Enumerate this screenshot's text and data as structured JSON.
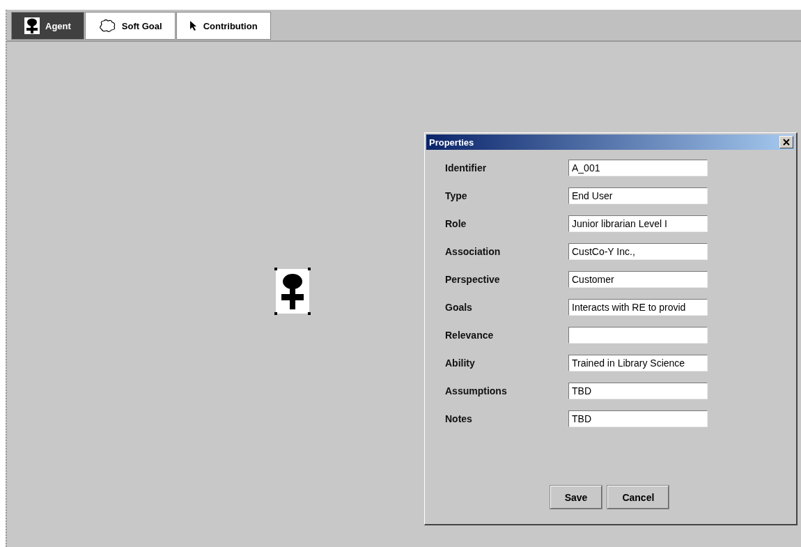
{
  "toolbar": {
    "tools": [
      {
        "kind": "agent",
        "label": "Agent",
        "selected": true
      },
      {
        "kind": "softgoal",
        "label": "Soft Goal",
        "selected": false
      },
      {
        "kind": "pointer",
        "label": "Contribution",
        "selected": false
      }
    ]
  },
  "canvas": {
    "nodes": [
      {
        "kind": "agent",
        "selected": true
      }
    ]
  },
  "dialog": {
    "title": "Properties",
    "fields": [
      {
        "label": "Identifier",
        "value": "A_001"
      },
      {
        "label": "Type",
        "value": "End User"
      },
      {
        "label": "Role",
        "value": "Junior librarian Level I"
      },
      {
        "label": "Association",
        "value": "CustCo-Y Inc.,"
      },
      {
        "label": "Perspective",
        "value": "Customer"
      },
      {
        "label": "Goals",
        "value": "Interacts with RE to provid"
      },
      {
        "label": "Relevance"
      },
      {
        "label": "Ability",
        "value": "Trained in Library Science"
      },
      {
        "label": "Assumptions",
        "value": "TBD"
      },
      {
        "label": "Notes",
        "value": "TBD"
      }
    ],
    "buttons": [
      "Save",
      "Cancel"
    ]
  }
}
